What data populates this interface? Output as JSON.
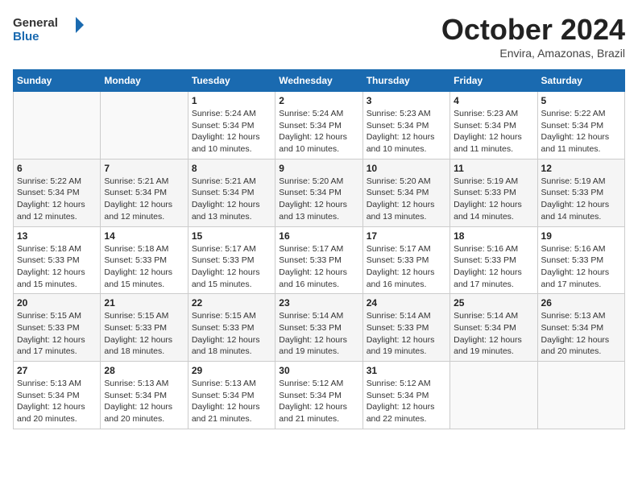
{
  "logo": {
    "line1": "General",
    "line2": "Blue"
  },
  "title": "October 2024",
  "location": "Envira, Amazonas, Brazil",
  "weekdays": [
    "Sunday",
    "Monday",
    "Tuesday",
    "Wednesday",
    "Thursday",
    "Friday",
    "Saturday"
  ],
  "weeks": [
    [
      {
        "day": "",
        "sunrise": "",
        "sunset": "",
        "daylight": ""
      },
      {
        "day": "",
        "sunrise": "",
        "sunset": "",
        "daylight": ""
      },
      {
        "day": "1",
        "sunrise": "Sunrise: 5:24 AM",
        "sunset": "Sunset: 5:34 PM",
        "daylight": "Daylight: 12 hours and 10 minutes."
      },
      {
        "day": "2",
        "sunrise": "Sunrise: 5:24 AM",
        "sunset": "Sunset: 5:34 PM",
        "daylight": "Daylight: 12 hours and 10 minutes."
      },
      {
        "day": "3",
        "sunrise": "Sunrise: 5:23 AM",
        "sunset": "Sunset: 5:34 PM",
        "daylight": "Daylight: 12 hours and 10 minutes."
      },
      {
        "day": "4",
        "sunrise": "Sunrise: 5:23 AM",
        "sunset": "Sunset: 5:34 PM",
        "daylight": "Daylight: 12 hours and 11 minutes."
      },
      {
        "day": "5",
        "sunrise": "Sunrise: 5:22 AM",
        "sunset": "Sunset: 5:34 PM",
        "daylight": "Daylight: 12 hours and 11 minutes."
      }
    ],
    [
      {
        "day": "6",
        "sunrise": "Sunrise: 5:22 AM",
        "sunset": "Sunset: 5:34 PM",
        "daylight": "Daylight: 12 hours and 12 minutes."
      },
      {
        "day": "7",
        "sunrise": "Sunrise: 5:21 AM",
        "sunset": "Sunset: 5:34 PM",
        "daylight": "Daylight: 12 hours and 12 minutes."
      },
      {
        "day": "8",
        "sunrise": "Sunrise: 5:21 AM",
        "sunset": "Sunset: 5:34 PM",
        "daylight": "Daylight: 12 hours and 13 minutes."
      },
      {
        "day": "9",
        "sunrise": "Sunrise: 5:20 AM",
        "sunset": "Sunset: 5:34 PM",
        "daylight": "Daylight: 12 hours and 13 minutes."
      },
      {
        "day": "10",
        "sunrise": "Sunrise: 5:20 AM",
        "sunset": "Sunset: 5:34 PM",
        "daylight": "Daylight: 12 hours and 13 minutes."
      },
      {
        "day": "11",
        "sunrise": "Sunrise: 5:19 AM",
        "sunset": "Sunset: 5:33 PM",
        "daylight": "Daylight: 12 hours and 14 minutes."
      },
      {
        "day": "12",
        "sunrise": "Sunrise: 5:19 AM",
        "sunset": "Sunset: 5:33 PM",
        "daylight": "Daylight: 12 hours and 14 minutes."
      }
    ],
    [
      {
        "day": "13",
        "sunrise": "Sunrise: 5:18 AM",
        "sunset": "Sunset: 5:33 PM",
        "daylight": "Daylight: 12 hours and 15 minutes."
      },
      {
        "day": "14",
        "sunrise": "Sunrise: 5:18 AM",
        "sunset": "Sunset: 5:33 PM",
        "daylight": "Daylight: 12 hours and 15 minutes."
      },
      {
        "day": "15",
        "sunrise": "Sunrise: 5:17 AM",
        "sunset": "Sunset: 5:33 PM",
        "daylight": "Daylight: 12 hours and 15 minutes."
      },
      {
        "day": "16",
        "sunrise": "Sunrise: 5:17 AM",
        "sunset": "Sunset: 5:33 PM",
        "daylight": "Daylight: 12 hours and 16 minutes."
      },
      {
        "day": "17",
        "sunrise": "Sunrise: 5:17 AM",
        "sunset": "Sunset: 5:33 PM",
        "daylight": "Daylight: 12 hours and 16 minutes."
      },
      {
        "day": "18",
        "sunrise": "Sunrise: 5:16 AM",
        "sunset": "Sunset: 5:33 PM",
        "daylight": "Daylight: 12 hours and 17 minutes."
      },
      {
        "day": "19",
        "sunrise": "Sunrise: 5:16 AM",
        "sunset": "Sunset: 5:33 PM",
        "daylight": "Daylight: 12 hours and 17 minutes."
      }
    ],
    [
      {
        "day": "20",
        "sunrise": "Sunrise: 5:15 AM",
        "sunset": "Sunset: 5:33 PM",
        "daylight": "Daylight: 12 hours and 17 minutes."
      },
      {
        "day": "21",
        "sunrise": "Sunrise: 5:15 AM",
        "sunset": "Sunset: 5:33 PM",
        "daylight": "Daylight: 12 hours and 18 minutes."
      },
      {
        "day": "22",
        "sunrise": "Sunrise: 5:15 AM",
        "sunset": "Sunset: 5:33 PM",
        "daylight": "Daylight: 12 hours and 18 minutes."
      },
      {
        "day": "23",
        "sunrise": "Sunrise: 5:14 AM",
        "sunset": "Sunset: 5:33 PM",
        "daylight": "Daylight: 12 hours and 19 minutes."
      },
      {
        "day": "24",
        "sunrise": "Sunrise: 5:14 AM",
        "sunset": "Sunset: 5:33 PM",
        "daylight": "Daylight: 12 hours and 19 minutes."
      },
      {
        "day": "25",
        "sunrise": "Sunrise: 5:14 AM",
        "sunset": "Sunset: 5:34 PM",
        "daylight": "Daylight: 12 hours and 19 minutes."
      },
      {
        "day": "26",
        "sunrise": "Sunrise: 5:13 AM",
        "sunset": "Sunset: 5:34 PM",
        "daylight": "Daylight: 12 hours and 20 minutes."
      }
    ],
    [
      {
        "day": "27",
        "sunrise": "Sunrise: 5:13 AM",
        "sunset": "Sunset: 5:34 PM",
        "daylight": "Daylight: 12 hours and 20 minutes."
      },
      {
        "day": "28",
        "sunrise": "Sunrise: 5:13 AM",
        "sunset": "Sunset: 5:34 PM",
        "daylight": "Daylight: 12 hours and 20 minutes."
      },
      {
        "day": "29",
        "sunrise": "Sunrise: 5:13 AM",
        "sunset": "Sunset: 5:34 PM",
        "daylight": "Daylight: 12 hours and 21 minutes."
      },
      {
        "day": "30",
        "sunrise": "Sunrise: 5:12 AM",
        "sunset": "Sunset: 5:34 PM",
        "daylight": "Daylight: 12 hours and 21 minutes."
      },
      {
        "day": "31",
        "sunrise": "Sunrise: 5:12 AM",
        "sunset": "Sunset: 5:34 PM",
        "daylight": "Daylight: 12 hours and 22 minutes."
      },
      {
        "day": "",
        "sunrise": "",
        "sunset": "",
        "daylight": ""
      },
      {
        "day": "",
        "sunrise": "",
        "sunset": "",
        "daylight": ""
      }
    ]
  ]
}
